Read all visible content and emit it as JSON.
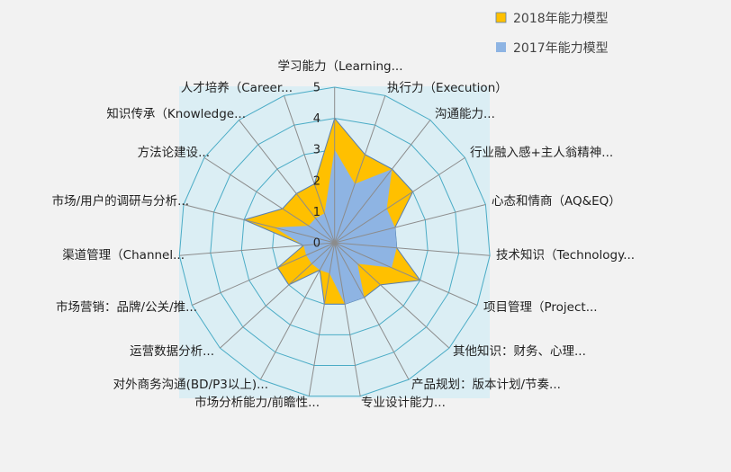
{
  "chart_data": {
    "type": "radar",
    "categories": [
      "学习能力（Learning...",
      "执行力（Execution）",
      "沟通能力...",
      "行业融入感+主人翁精神...",
      "心态和情商（AQ&EQ）",
      "技术知识（Technology...",
      "项目管理（Project...",
      "其他知识：财务、心理...",
      "产品规划：版本计划/节奏...",
      "专业设计能力...",
      "市场分析能力/前瞻性...",
      "对外商务沟通(BD/P3以上)...",
      "运营数据分析...",
      "市场营销：品牌/公关/推...",
      "渠道管理（Channel...",
      "市场/用户的调研与分析...",
      "方法论建设...",
      "知识传承（Knowledge...",
      "人才培养（Career..."
    ],
    "series": [
      {
        "name": "2018年能力模型",
        "color": "#ffc000",
        "values": [
          4,
          3,
          3,
          3,
          2,
          2,
          3,
          2,
          2,
          2,
          2,
          1,
          2,
          2,
          1,
          3,
          2,
          2,
          2
        ]
      },
      {
        "name": "2017年能力模型",
        "color": "#8eb4e3",
        "values": [
          3,
          2,
          3,
          2,
          2,
          2,
          2,
          1,
          2,
          2,
          1,
          1,
          1,
          1,
          1,
          2,
          1,
          1,
          1
        ]
      }
    ],
    "rlim": [
      0,
      5
    ],
    "ticks": [
      "0",
      "1",
      "2",
      "3",
      "4",
      "5"
    ],
    "grid": true,
    "legend": "top-right",
    "colors": {
      "background": "#f2f2f2",
      "plot_area": "#dbeef4",
      "grid": "#4bacc6",
      "spokes": "#8c8c8c"
    }
  }
}
